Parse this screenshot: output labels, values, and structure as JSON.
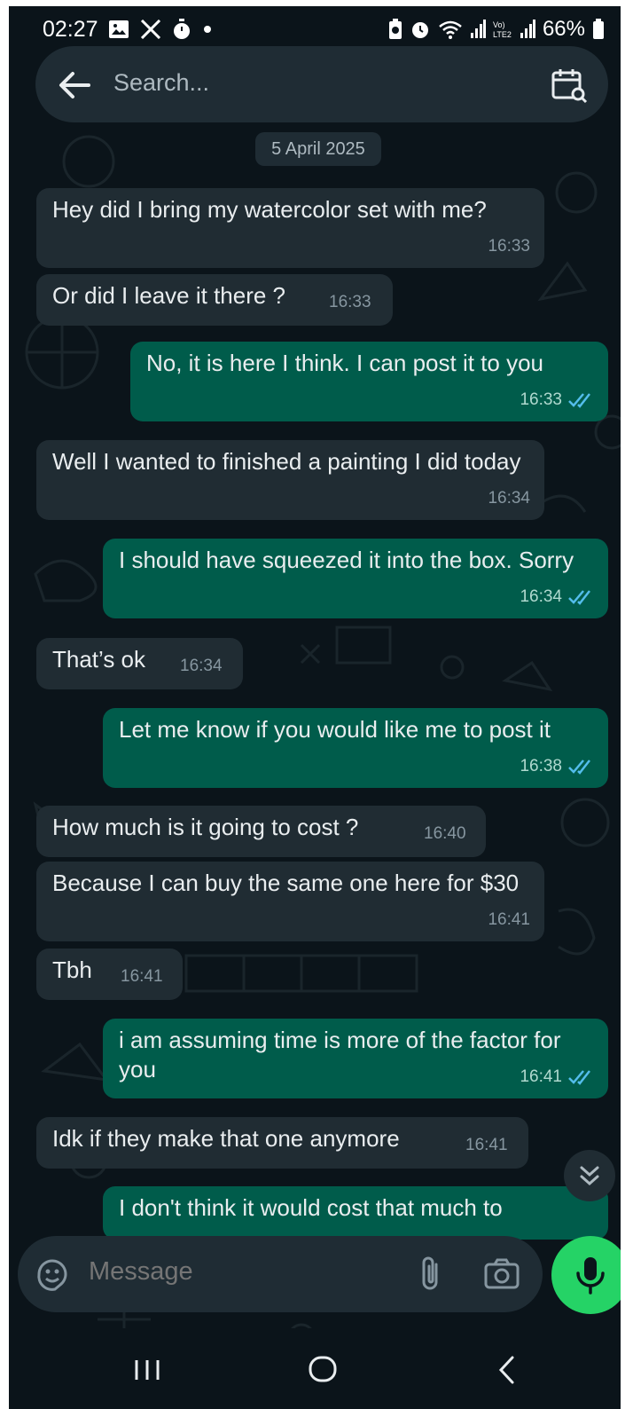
{
  "status_bar": {
    "time": "02:27",
    "battery": "66%",
    "left_icons": [
      "gallery-icon",
      "x-logo-icon",
      "timer-icon",
      "dot-icon"
    ],
    "right_icons": [
      "battery-saver-icon",
      "alarm-icon",
      "wifi-icon",
      "signal-icon",
      "volte-icon",
      "signal-icon",
      "battery-icon"
    ],
    "volte_label": "Vo)\nLTE2"
  },
  "search": {
    "placeholder": "Search..."
  },
  "date_chip": "5 April 2025",
  "messages": [
    {
      "dir": "in",
      "text": "Hey did I bring my watercolor set with me?",
      "time": "16:33"
    },
    {
      "dir": "in",
      "text": "Or did I leave it there ?",
      "time": "16:33"
    },
    {
      "dir": "out",
      "text": "No, it is here I think. I can post it to you",
      "time": "16:33",
      "status": "read"
    },
    {
      "dir": "in",
      "text": "Well I wanted to finished a painting I did today",
      "time": "16:34"
    },
    {
      "dir": "out",
      "text": "I should have squeezed it into the box. Sorry",
      "time": "16:34",
      "status": "read"
    },
    {
      "dir": "in",
      "text": "That’s ok",
      "time": "16:34"
    },
    {
      "dir": "out",
      "text": "Let me know if you would like me to post it",
      "time": "16:38",
      "status": "read"
    },
    {
      "dir": "in",
      "text": "How much is it going to cost ?",
      "time": "16:40"
    },
    {
      "dir": "in",
      "text": "Because I can buy the same one here for $30",
      "time": "16:41"
    },
    {
      "dir": "in",
      "text": "Tbh",
      "time": "16:41"
    },
    {
      "dir": "out",
      "text": "i am assuming time is more of the factor for you",
      "time": "16:41",
      "status": "read"
    },
    {
      "dir": "in",
      "text": "Idk if they make that one anymore",
      "time": "16:41"
    },
    {
      "dir": "out",
      "text": "I don't think it would cost that much to",
      "time": ""
    }
  ],
  "composer": {
    "placeholder": "Message"
  },
  "colors": {
    "background": "#0b141a",
    "incoming_bubble": "#202c33",
    "outgoing_bubble": "#005c4b",
    "read_ticks": "#53bdeb",
    "accent": "#25d366"
  }
}
